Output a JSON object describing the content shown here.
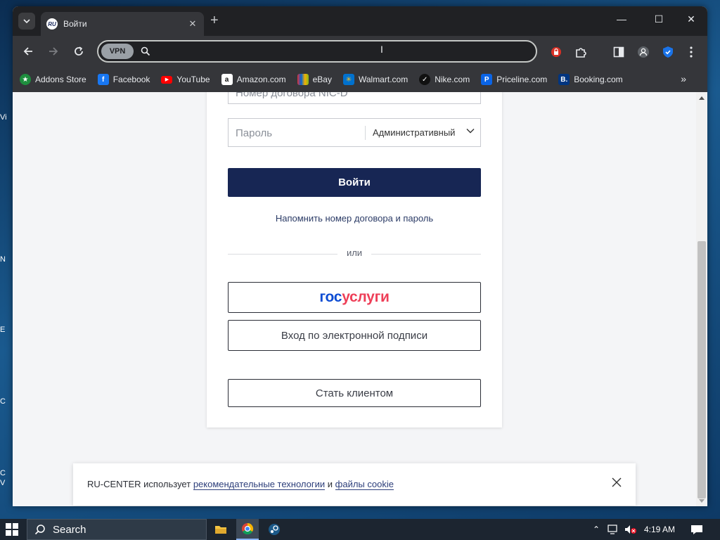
{
  "browser": {
    "tab": {
      "title": "Войти",
      "favicon_text": "RU"
    },
    "address_bar": {
      "value": "",
      "vpn_label": "VPN"
    },
    "bookmarks": [
      {
        "label": "Addons Store",
        "icon": "addons-store-icon",
        "color": "#1e8e3e"
      },
      {
        "label": "Facebook",
        "icon": "facebook-icon",
        "color": "#1877f2"
      },
      {
        "label": "YouTube",
        "icon": "youtube-icon",
        "color": "#ff0000"
      },
      {
        "label": "Amazon.com",
        "icon": "amazon-icon",
        "color": "#ffffff"
      },
      {
        "label": "eBay",
        "icon": "ebay-icon",
        "color": "#e53238"
      },
      {
        "label": "Walmart.com",
        "icon": "walmart-icon",
        "color": "#0071ce"
      },
      {
        "label": "Nike.com",
        "icon": "nike-icon",
        "color": "#111111"
      },
      {
        "label": "Priceline.com",
        "icon": "priceline-icon",
        "color": "#0a64e6"
      },
      {
        "label": "Booking.com",
        "icon": "booking-icon",
        "color": "#003580"
      }
    ]
  },
  "login": {
    "contract_placeholder": "Номер договора NIC-D",
    "password_placeholder": "Пароль",
    "password_type": "Административный",
    "submit": "Войти",
    "reminder": "Напомнить номер договора и пароль",
    "or": "или",
    "gosuslugi_a": "гос",
    "gosuslugi_b": "услуги",
    "signature": "Вход по электронной подписи",
    "become_client": "Стать клиентом"
  },
  "cookie": {
    "prefix": "RU-CENTER использует ",
    "link1": "рекомендательные технологии",
    "middle": " и ",
    "link2": "файлы cookie"
  },
  "taskbar": {
    "search_label": "Search",
    "time": "4:19 AM"
  },
  "desktop_icon_labels": [
    "Vi",
    "N",
    "E",
    "C",
    "C V"
  ],
  "colors": {
    "primary_button": "#172654",
    "gos_blue": "#0d4cd3",
    "gos_red": "#ee3f58"
  }
}
